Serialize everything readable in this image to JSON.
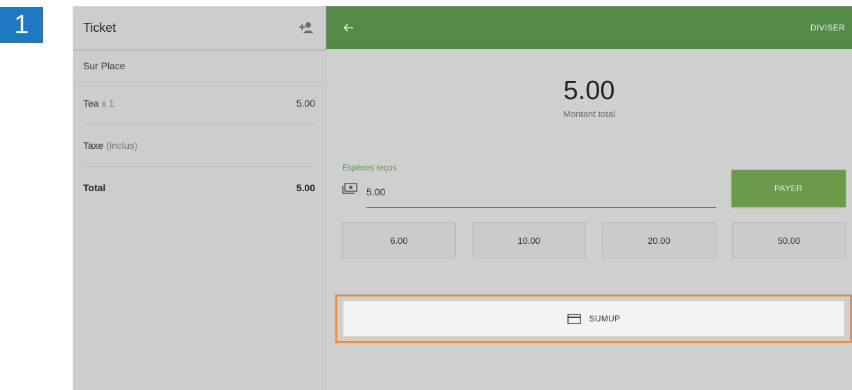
{
  "step": {
    "number": "1",
    "color": "#1f78c2"
  },
  "ticket": {
    "title": "Ticket",
    "add_customer_icon": "add-person-icon",
    "dining_option": "Sur Place",
    "items": [
      {
        "name": "Tea",
        "qty": "x 1",
        "price": "5.00"
      }
    ],
    "tax": {
      "label": "Taxe",
      "note": "(inclus)"
    },
    "total": {
      "label": "Total",
      "value": "5.00"
    }
  },
  "payment": {
    "header_color": "#528b48",
    "back_icon": "arrow-left-icon",
    "split_label": "DIVISER",
    "amount": "5.00",
    "amount_label": "Montant total",
    "cash_label": "Espèces reçus",
    "cash_icon": "cash-icon",
    "cash_value": "5.00",
    "pay_label": "PAYER",
    "quick_amounts": [
      "6.00",
      "10.00",
      "20.00",
      "50.00"
    ],
    "sumup": {
      "icon": "credit-card-icon",
      "label": "SUMUP",
      "highlight_color": "#ee8d3c"
    }
  }
}
